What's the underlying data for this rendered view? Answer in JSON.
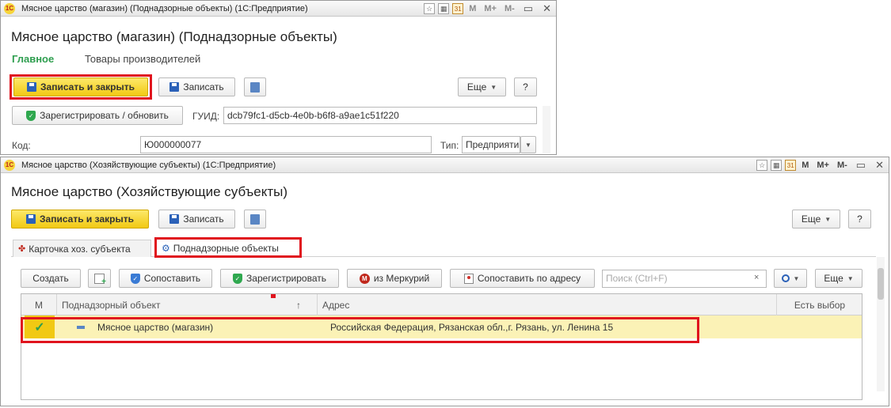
{
  "win1": {
    "title": "Мясное царство (магазин) (Поднадзорные объекты)  (1С:Предприятие)",
    "form_title": "Мясное царство (магазин) (Поднадзорные объекты)",
    "tabs": [
      "Главное",
      "Товары производителей"
    ],
    "save_close_label": "Записать и закрыть",
    "save_label": "Записать",
    "more_label": "Еще",
    "help_label": "?",
    "register_label": "Зарегистрировать / обновить",
    "guid_label": "ГУИД:",
    "guid_value": "dcb79fc1-d5cb-4e0b-b6f8-a9ae1c51f220",
    "code_label": "Код:",
    "code_value": "Ю000000077",
    "type_label": "Тип:",
    "type_value": "Предприяти"
  },
  "win2": {
    "title": "Мясное царство (Хозяйствующие субъекты)  (1С:Предприятие)",
    "form_title": "Мясное царство (Хозяйствующие субъекты)",
    "save_close_label": "Записать и закрыть",
    "save_label": "Записать",
    "more_label": "Еще",
    "help_label": "?",
    "tabs": [
      "Карточка хоз. субъекта",
      "Поднадзорные объекты"
    ],
    "toolbar": {
      "create": "Создать",
      "match": "Сопоставить",
      "register": "Зарегистрировать",
      "from_mercury": "из Меркурий",
      "match_address": "Сопоставить по адресу",
      "search_placeholder": "Поиск (Ctrl+F)",
      "more": "Еще"
    },
    "table": {
      "columns": [
        "М",
        "Поднадзорный объект",
        "Адрес",
        "Есть выбор"
      ],
      "rows": [
        {
          "mark": "✓",
          "object": "Мясное царство (магазин)",
          "address": "Российская Федерация, Рязанская обл.,г. Рязань, ул. Ленина 15",
          "choice": ""
        }
      ]
    }
  },
  "titlebar_controls": [
    "M",
    "M+",
    "M-"
  ],
  "colors": {
    "accent_green": "#2e9e4f",
    "primary_yellow": "#f5d225",
    "highlight_red": "#e0141e",
    "selected_row": "#fbf2b6"
  }
}
